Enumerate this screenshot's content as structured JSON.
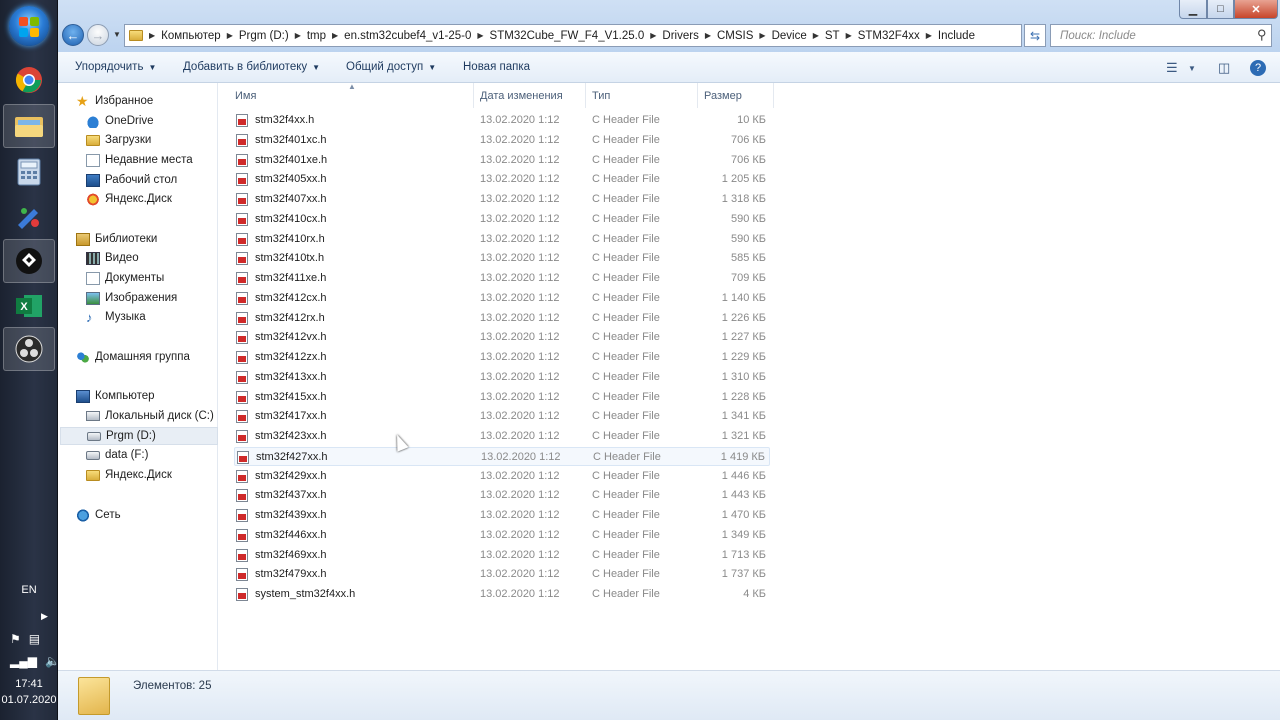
{
  "taskbar": {
    "apps": [
      "windows-start",
      "chrome",
      "explorer",
      "calculator",
      "paint",
      "obs-virtual",
      "excel",
      "obs-studio"
    ],
    "lang": "EN",
    "time": "17:41",
    "date": "01.07.2020"
  },
  "window": {
    "controls": {
      "minimize": "▁",
      "maximize": "□",
      "close": "✕"
    }
  },
  "address": {
    "crumbs": [
      "Компьютер",
      "Prgm (D:)",
      "tmp",
      "en.stm32cubef4_v1-25-0",
      "STM32Cube_FW_F4_V1.25.0",
      "Drivers",
      "CMSIS",
      "Device",
      "ST",
      "STM32F4xx",
      "Include"
    ]
  },
  "search": {
    "placeholder": "Поиск: Include"
  },
  "toolbar": {
    "organize": "Упорядочить",
    "add_to_library": "Добавить в библиотеку",
    "share": "Общий доступ",
    "new_folder": "Новая папка"
  },
  "nav": {
    "favorites": "Избранное",
    "onedrive": "OneDrive",
    "downloads": "Загрузки",
    "recent": "Недавние места",
    "desktop": "Рабочий стол",
    "yandex_disk": "Яндекс.Диск",
    "libraries": "Библиотеки",
    "video": "Видео",
    "documents": "Документы",
    "images": "Изображения",
    "music": "Музыка",
    "homegroup": "Домашняя группа",
    "computer": "Компьютер",
    "local_c": "Локальный диск (C:)",
    "prgm_d": "Prgm (D:)",
    "data_f": "data (F:)",
    "yandex_disk2": "Яндекс.Диск",
    "network": "Сеть"
  },
  "columns": {
    "name": "Имя",
    "date": "Дата изменения",
    "type": "Тип",
    "size": "Размер"
  },
  "files": [
    {
      "name": "stm32f4xx.h",
      "date": "13.02.2020 1:12",
      "type": "C Header File",
      "size": "10 КБ"
    },
    {
      "name": "stm32f401xc.h",
      "date": "13.02.2020 1:12",
      "type": "C Header File",
      "size": "706 КБ"
    },
    {
      "name": "stm32f401xe.h",
      "date": "13.02.2020 1:12",
      "type": "C Header File",
      "size": "706 КБ"
    },
    {
      "name": "stm32f405xx.h",
      "date": "13.02.2020 1:12",
      "type": "C Header File",
      "size": "1 205 КБ"
    },
    {
      "name": "stm32f407xx.h",
      "date": "13.02.2020 1:12",
      "type": "C Header File",
      "size": "1 318 КБ"
    },
    {
      "name": "stm32f410cx.h",
      "date": "13.02.2020 1:12",
      "type": "C Header File",
      "size": "590 КБ"
    },
    {
      "name": "stm32f410rx.h",
      "date": "13.02.2020 1:12",
      "type": "C Header File",
      "size": "590 КБ"
    },
    {
      "name": "stm32f410tx.h",
      "date": "13.02.2020 1:12",
      "type": "C Header File",
      "size": "585 КБ"
    },
    {
      "name": "stm32f411xe.h",
      "date": "13.02.2020 1:12",
      "type": "C Header File",
      "size": "709 КБ"
    },
    {
      "name": "stm32f412cx.h",
      "date": "13.02.2020 1:12",
      "type": "C Header File",
      "size": "1 140 КБ"
    },
    {
      "name": "stm32f412rx.h",
      "date": "13.02.2020 1:12",
      "type": "C Header File",
      "size": "1 226 КБ"
    },
    {
      "name": "stm32f412vx.h",
      "date": "13.02.2020 1:12",
      "type": "C Header File",
      "size": "1 227 КБ"
    },
    {
      "name": "stm32f412zx.h",
      "date": "13.02.2020 1:12",
      "type": "C Header File",
      "size": "1 229 КБ"
    },
    {
      "name": "stm32f413xx.h",
      "date": "13.02.2020 1:12",
      "type": "C Header File",
      "size": "1 310 КБ"
    },
    {
      "name": "stm32f415xx.h",
      "date": "13.02.2020 1:12",
      "type": "C Header File",
      "size": "1 228 КБ"
    },
    {
      "name": "stm32f417xx.h",
      "date": "13.02.2020 1:12",
      "type": "C Header File",
      "size": "1 341 КБ"
    },
    {
      "name": "stm32f423xx.h",
      "date": "13.02.2020 1:12",
      "type": "C Header File",
      "size": "1 321 КБ"
    },
    {
      "name": "stm32f427xx.h",
      "date": "13.02.2020 1:12",
      "type": "C Header File",
      "size": "1 419 КБ"
    },
    {
      "name": "stm32f429xx.h",
      "date": "13.02.2020 1:12",
      "type": "C Header File",
      "size": "1 446 КБ"
    },
    {
      "name": "stm32f437xx.h",
      "date": "13.02.2020 1:12",
      "type": "C Header File",
      "size": "1 443 КБ"
    },
    {
      "name": "stm32f439xx.h",
      "date": "13.02.2020 1:12",
      "type": "C Header File",
      "size": "1 470 КБ"
    },
    {
      "name": "stm32f446xx.h",
      "date": "13.02.2020 1:12",
      "type": "C Header File",
      "size": "1 349 КБ"
    },
    {
      "name": "stm32f469xx.h",
      "date": "13.02.2020 1:12",
      "type": "C Header File",
      "size": "1 713 КБ"
    },
    {
      "name": "stm32f479xx.h",
      "date": "13.02.2020 1:12",
      "type": "C Header File",
      "size": "1 737 КБ"
    },
    {
      "name": "system_stm32f4xx.h",
      "date": "13.02.2020 1:12",
      "type": "C Header File",
      "size": "4 КБ"
    }
  ],
  "status": {
    "items_count": "Элементов: 25"
  },
  "colors": {
    "accent": "#2a7cd6",
    "file_icon": "#cf2a2a"
  }
}
